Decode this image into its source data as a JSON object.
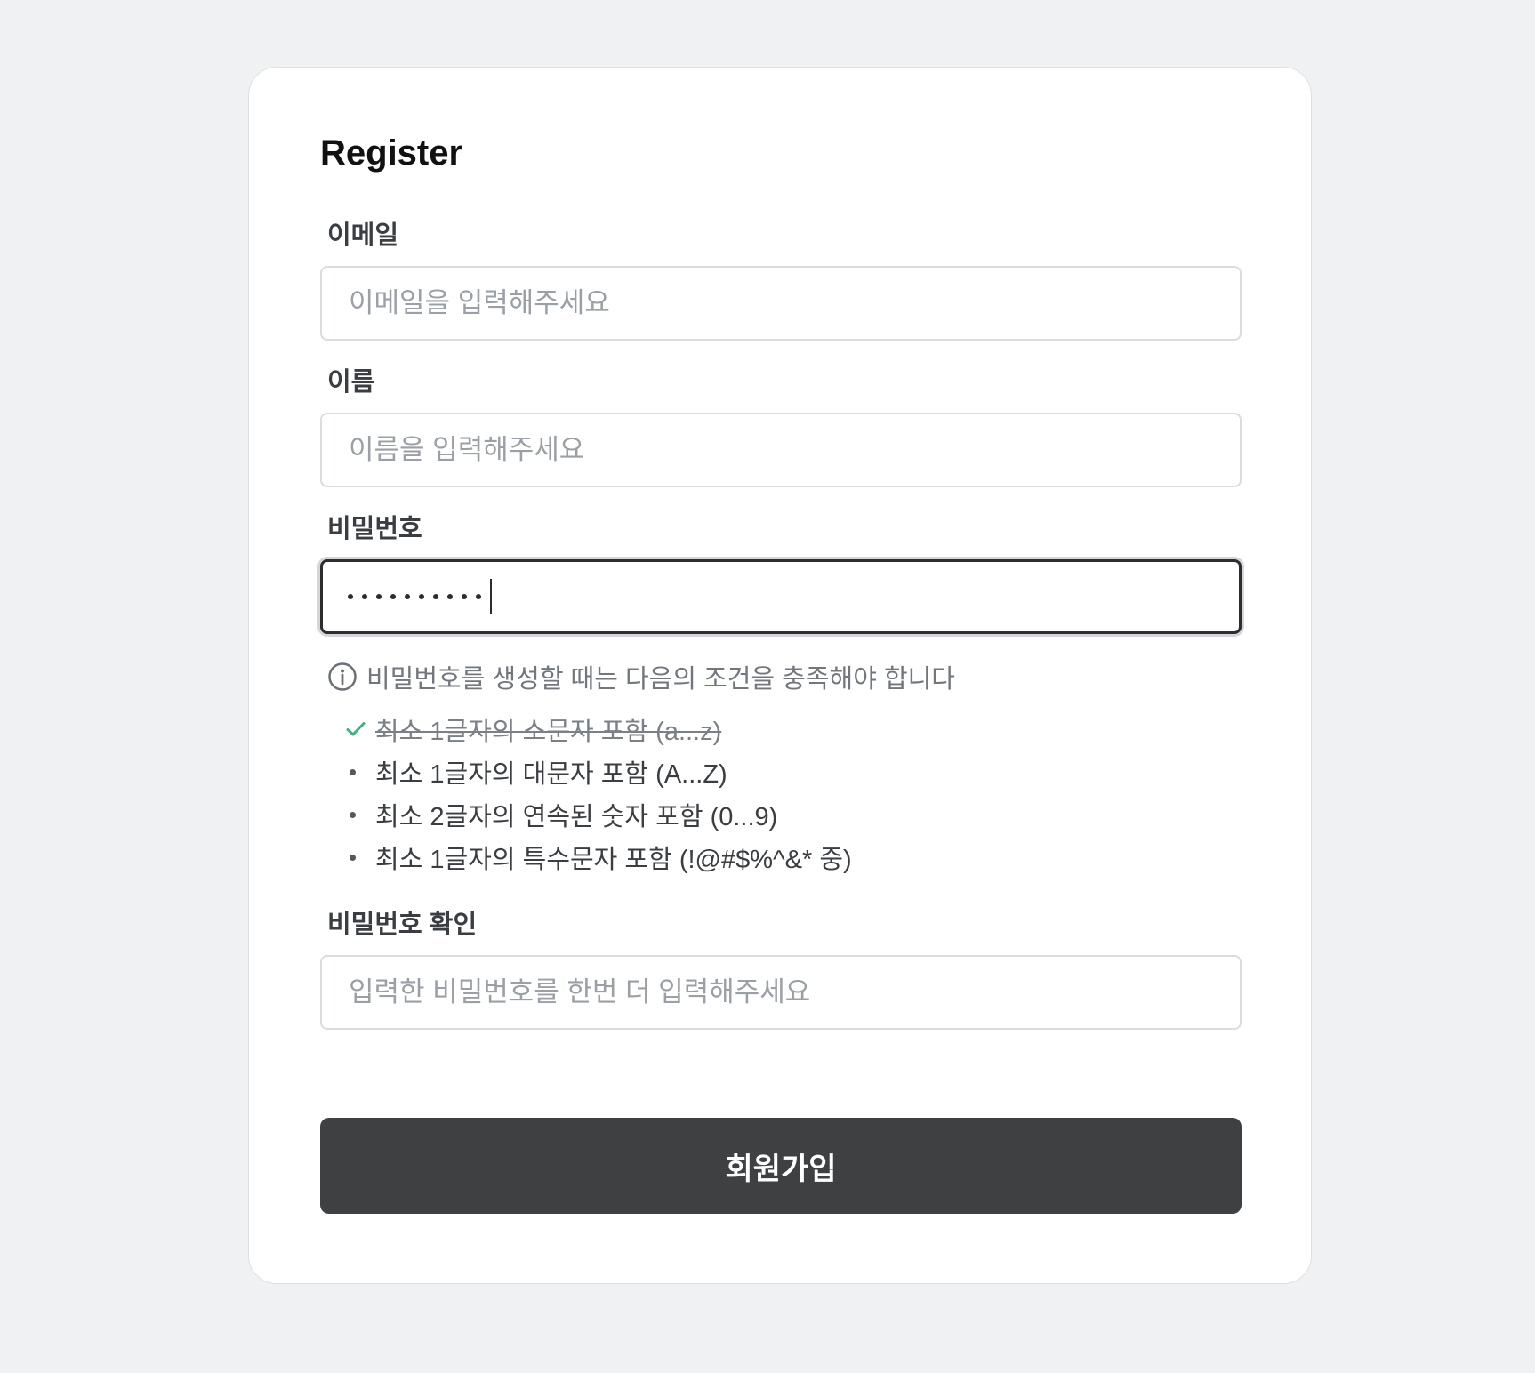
{
  "form": {
    "title": "Register",
    "email": {
      "label": "이메일",
      "placeholder": "이메일을 입력해주세요"
    },
    "name": {
      "label": "이름",
      "placeholder": "이름을 입력해주세요"
    },
    "password": {
      "label": "비밀번호",
      "masked_length": 10,
      "hint": "비밀번호를 생성할 때는 다음의 조건을 충족해야 합니다",
      "rules": [
        {
          "text": "최소 1글자의 소문자 포함 (a...z)",
          "satisfied": true
        },
        {
          "text": "최소 1글자의 대문자 포함 (A...Z)",
          "satisfied": false
        },
        {
          "text": "최소 2글자의 연속된 숫자 포함 (0...9)",
          "satisfied": false
        },
        {
          "text": "최소 1글자의 특수문자 포함 (!@#$%^&* 중)",
          "satisfied": false
        }
      ]
    },
    "password_confirm": {
      "label": "비밀번호 확인",
      "placeholder": "입력한 비밀번호를 한번 더 입력해주세요"
    },
    "submit_label": "회원가입"
  },
  "icons": {
    "hint": "info-circle-icon",
    "rule_done": "check-icon",
    "rule_pending": "bullet-dot"
  },
  "colors": {
    "background": "#f0f1f3",
    "card": "#ffffff",
    "button": "#3f4042",
    "check": "#3fb37f",
    "text_muted": "#72777e"
  }
}
